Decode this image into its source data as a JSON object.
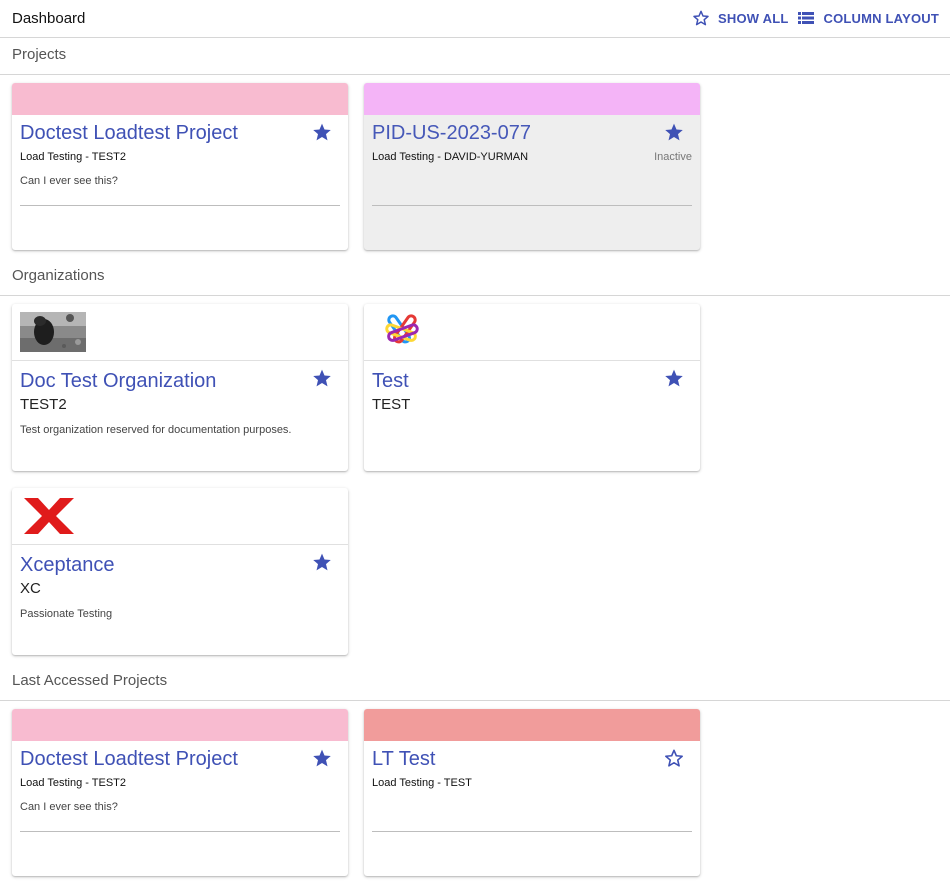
{
  "header": {
    "title": "Dashboard",
    "show_all_label": "SHOW ALL",
    "column_layout_label": "COLUMN LAYOUT"
  },
  "sections": {
    "projects": "Projects",
    "organizations": "Organizations",
    "last_accessed": "Last Accessed Projects"
  },
  "projects": [
    {
      "title": "Doctest Loadtest Project",
      "subtitle": "Load Testing - TEST2",
      "description": "Can I ever see this?",
      "status": "",
      "favorite": true,
      "color": "#f8bbd0"
    },
    {
      "title": "PID-US-2023-077",
      "subtitle": "Load Testing - DAVID-YURMAN",
      "description": "",
      "status": "Inactive",
      "favorite": true,
      "color": "#f4b4f7"
    }
  ],
  "organizations": [
    {
      "title": "Doc Test Organization",
      "code": "TEST2",
      "description": "Test organization reserved for documentation purposes.",
      "favorite": true,
      "logo": "photo-logo"
    },
    {
      "title": "Test",
      "code": "TEST",
      "description": "",
      "favorite": true,
      "logo": "test-tubes-logo"
    },
    {
      "title": "Xceptance",
      "code": "XC",
      "description": "Passionate Testing",
      "favorite": true,
      "logo": "xceptance-x-logo"
    }
  ],
  "last_accessed": [
    {
      "title": "Doctest Loadtest Project",
      "subtitle": "Load Testing - TEST2",
      "description": "Can I ever see this?",
      "favorite": true,
      "color": "#f8bbd0"
    },
    {
      "title": "LT Test",
      "subtitle": "Load Testing - TEST",
      "description": "",
      "favorite": false,
      "color": "#f19c9b"
    }
  ],
  "colors": {
    "accent": "#3f51b5",
    "inactive_bg": "#eeeeee"
  }
}
